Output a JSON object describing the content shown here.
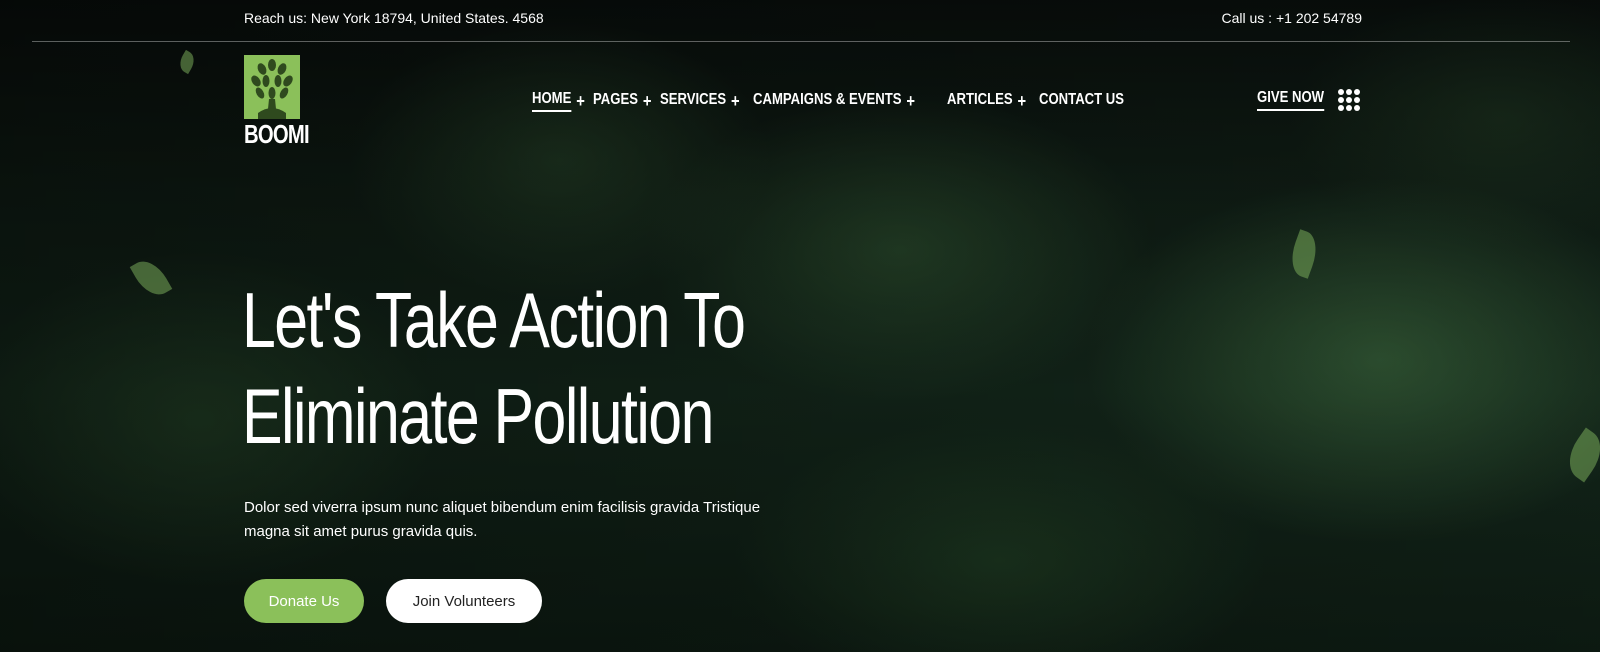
{
  "topbar": {
    "reach": "Reach us: New York 18794, United States. 4568",
    "call": "Call us :  +1 202 54789"
  },
  "logo": {
    "text": "BOOMI",
    "icon": "tree-icon"
  },
  "nav": {
    "items": [
      {
        "label": "HOME",
        "has_submenu": true,
        "active": true
      },
      {
        "label": "PAGES",
        "has_submenu": true
      },
      {
        "label": "SERVICES",
        "has_submenu": true
      },
      {
        "label": "CAMPAIGNS & EVENTS",
        "has_submenu": true
      },
      {
        "label": "ARTICLES",
        "has_submenu": true
      },
      {
        "label": "CONTACT US",
        "has_submenu": false
      }
    ],
    "plus": "+"
  },
  "header_actions": {
    "give_now": "GIVE NOW",
    "menu_icon": "grid-menu-icon"
  },
  "hero": {
    "headline_line1": "Let's Take Action To",
    "headline_line2": "Eliminate Pollution",
    "description": "Dolor sed viverra ipsum nunc aliquet bibendum enim facilisis gravida Tristique magna sit amet purus gravida quis.",
    "donate_label": "Donate Us",
    "join_label": "Join Volunteers"
  },
  "colors": {
    "accent": "#8bc05a",
    "background": "#0b1410"
  }
}
